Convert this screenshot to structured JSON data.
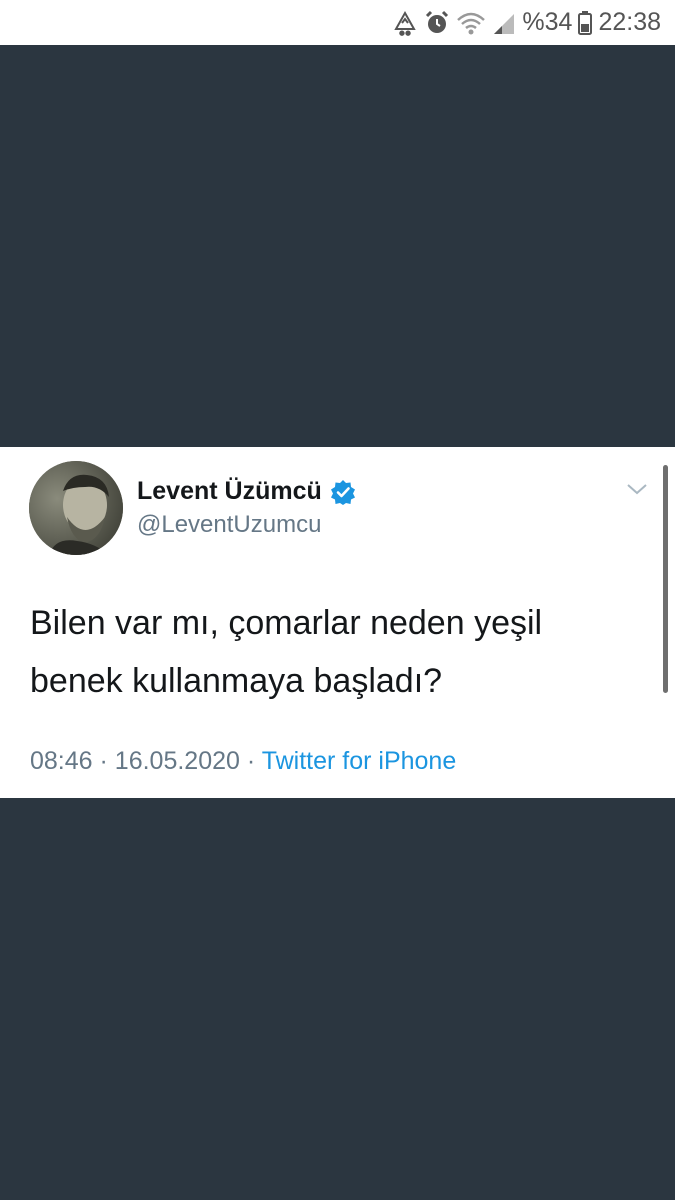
{
  "status_bar": {
    "battery": "%34",
    "time": "22:38",
    "icons": [
      "recycle-icon",
      "alarm-icon",
      "wifi-icon",
      "signal-icon",
      "battery-icon"
    ]
  },
  "tweet": {
    "author": {
      "name": "Levent Üzümcü",
      "handle": "@LeventUzumcu",
      "verified": true
    },
    "text_lines": [
      "Bilen var mı, çomarlar neden yeşil",
      "benek kullanmaya başladı?"
    ],
    "time": "08:46",
    "separator": "·",
    "date": "16.05.2020",
    "source": "Twitter for iPhone"
  },
  "colors": {
    "background": "#2b3640",
    "card": "#ffffff",
    "verified_badge": "#1b95e0",
    "link": "#1b95e0",
    "meta_text": "#657786"
  }
}
